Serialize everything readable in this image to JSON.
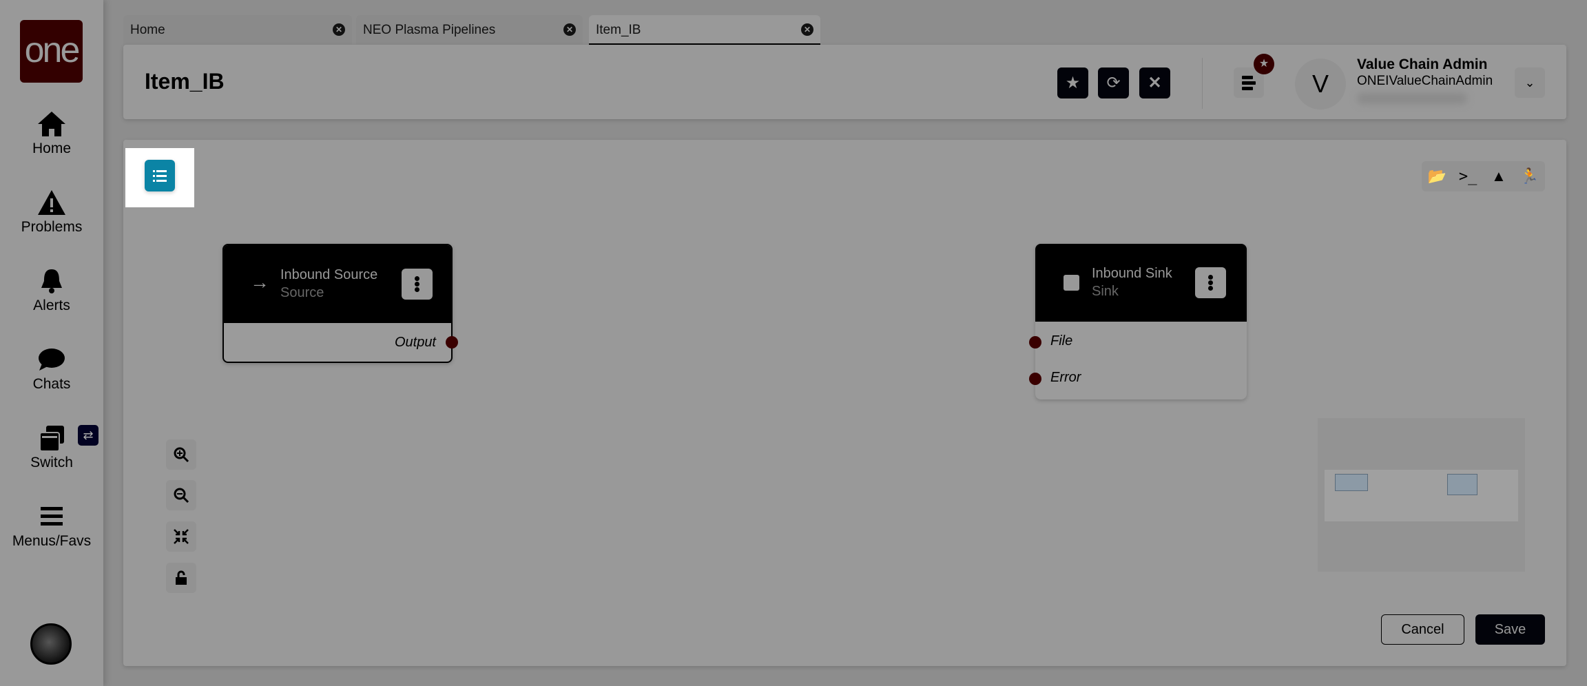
{
  "colors": {
    "accent": "#0b84a5",
    "brand": "#330000",
    "port": "#3a0000"
  },
  "logo": "one",
  "sidebar": {
    "items": [
      {
        "label": "Home",
        "icon": "home-icon"
      },
      {
        "label": "Problems",
        "icon": "warning-icon"
      },
      {
        "label": "Alerts",
        "icon": "bell-icon"
      },
      {
        "label": "Chats",
        "icon": "chat-icon"
      },
      {
        "label": "Switch",
        "icon": "switch-icon"
      },
      {
        "label": "Menus/Favs",
        "icon": "hamburger-icon"
      }
    ]
  },
  "tabs": [
    {
      "label": "Home"
    },
    {
      "label": "NEO Plasma Pipelines"
    },
    {
      "label": "Item_IB",
      "active": true
    }
  ],
  "header": {
    "title": "Item_IB",
    "user_name": "Value Chain Admin",
    "user_login": "ONEIValueChainAdmin",
    "avatar_letter": "V"
  },
  "canvas": {
    "nodes": [
      {
        "title": "Inbound Source",
        "subtitle": "Source",
        "icon": "arrow-right-icon",
        "outputs": [
          "Output"
        ]
      },
      {
        "title": "Inbound Sink",
        "subtitle": "Sink",
        "icon": "square-icon",
        "inputs": [
          "File",
          "Error"
        ]
      }
    ],
    "toolbar_icons": [
      "folder-open-icon",
      "terminal-icon",
      "mountain-icon",
      "running-icon"
    ],
    "zoom_icons": [
      "zoom-in-icon",
      "zoom-out-icon",
      "compress-icon",
      "unlock-icon"
    ]
  },
  "footer": {
    "cancel": "Cancel",
    "save": "Save"
  }
}
